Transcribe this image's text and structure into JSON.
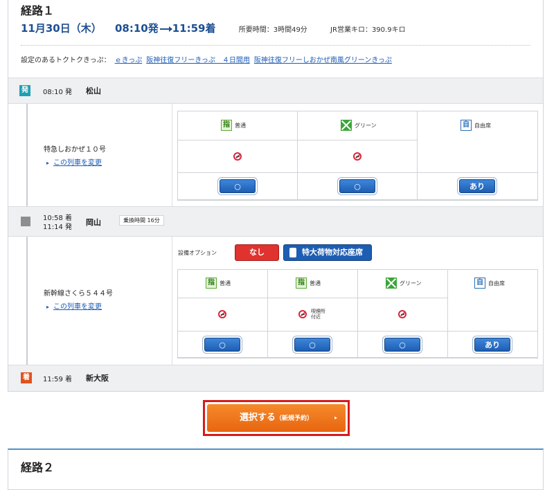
{
  "route1": {
    "title": "経路１",
    "date": "11月30日（木）",
    "depart": "08:10発",
    "arrive": "11:59着",
    "duration": "所要時間：3時間49分",
    "distance": "JR営業キロ：390.9キロ",
    "tokutoku_label": "設定のあるトクトクきっぷ：",
    "tokutoku_links": [
      "ｅきっぷ",
      "阪神往復フリーきっぷ　４日間用",
      "阪神往復フリーしおかぜ南風グリーンきっぷ"
    ]
  },
  "stations": {
    "departure": {
      "badge": "発",
      "badge_color": "#1f9fb5",
      "time": "08:10 発",
      "name": "松山"
    },
    "transfer": {
      "time1": "10:58 着",
      "time2": "11:14 発",
      "name": "岡山",
      "transfer_time": "乗換時間 16分"
    },
    "arrival": {
      "badge": "着",
      "badge_color": "#e0531f",
      "time": "11:59 着",
      "name": "新大阪"
    }
  },
  "train1": {
    "name": "特急しおかぜ１０号",
    "change_link": "この列車を変更",
    "seats": [
      {
        "icon": "shitei",
        "icon_text": "指",
        "label": "普通",
        "status": "no-smoking",
        "button": "○"
      },
      {
        "icon": "green",
        "icon_text": "",
        "label": "グリーン",
        "status": "no-smoking",
        "button": "○"
      },
      {
        "icon": "jiyu",
        "icon_text": "自",
        "label": "自由席",
        "status": "",
        "button": "あり"
      }
    ]
  },
  "train2": {
    "name": "新幹線さくら５４４号",
    "change_link": "この列車を変更",
    "option_label": "設備オプション",
    "option_none": "なし",
    "option_large": "特大荷物対応座席",
    "seats": [
      {
        "icon": "shitei",
        "icon_text": "指",
        "label": "普通",
        "status": "no-smoking",
        "note": "",
        "button": "○"
      },
      {
        "icon": "shitei",
        "icon_text": "指",
        "label": "普通",
        "status": "no-smoking",
        "note": "喫煙所\n付近",
        "button": "○"
      },
      {
        "icon": "green",
        "icon_text": "",
        "label": "グリーン",
        "status": "no-smoking",
        "note": "",
        "button": "○"
      },
      {
        "icon": "jiyu",
        "icon_text": "自",
        "label": "自由席",
        "status": "",
        "note": "",
        "button": "あり"
      }
    ]
  },
  "select_button": {
    "label": "選択する",
    "sub": "（新規予約）",
    "chevron": "▸"
  },
  "route2": {
    "title": "経路２"
  }
}
